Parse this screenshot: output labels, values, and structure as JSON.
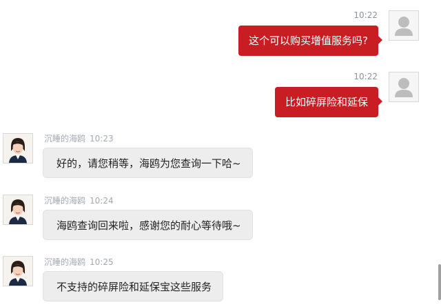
{
  "messages": [
    {
      "side": "out",
      "time": "10:22",
      "text": "这个可以购买增值服务吗?"
    },
    {
      "side": "out",
      "time": "10:22",
      "text": "比如碎屏险和延保"
    },
    {
      "side": "in",
      "sender": "沉睡的海鸥",
      "time": "10:23",
      "text": "好的，请您稍等，海鸥为您查询一下哈~"
    },
    {
      "side": "in",
      "sender": "沉睡的海鸥",
      "time": "10:24",
      "text": "海鸥查询回来啦，感谢您的耐心等待哦~"
    },
    {
      "side": "in",
      "sender": "沉睡的海鸥",
      "time": "10:25",
      "text": "不支持的碎屏险和延保宝这些服务"
    }
  ],
  "colors": {
    "outgoing_bubble": "#c81d23",
    "incoming_bubble": "#ededed",
    "timestamp": "#8a93a0"
  },
  "icons": {
    "user_avatar": "default-user-avatar-icon",
    "agent_avatar": "agent-avatar-photo"
  }
}
